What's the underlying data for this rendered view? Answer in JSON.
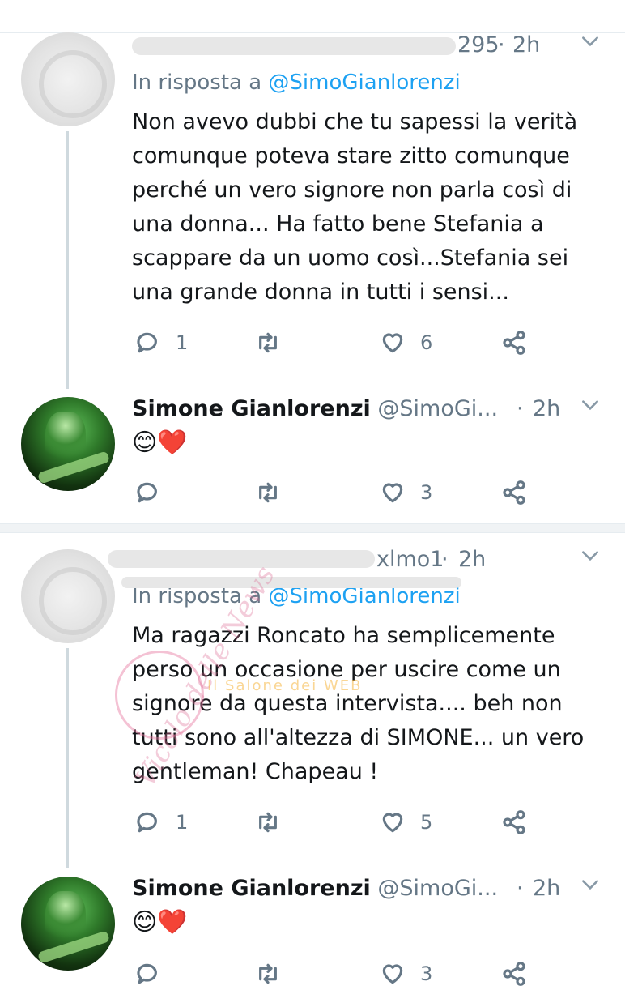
{
  "tweets": [
    {
      "type": "reply",
      "name": "",
      "handle_suffix": "295",
      "dot": "·",
      "time": "2h",
      "reply_prefix": "In risposta a",
      "reply_mention": "@SimoGianlorenzi",
      "text": "Non avevo dubbi che tu sapessi la  verità comunque poteva stare zitto comunque perché un vero signore non parla così di una donna... Ha fatto bene Stefania a scappare da un uomo così...Stefania sei una grande donna in tutti i sensi...",
      "actions": {
        "replies": "1",
        "retweets": "",
        "likes": "6"
      }
    },
    {
      "type": "author",
      "name": "Simone Gianlorenzi",
      "handle": "@SimoGi...",
      "dot": "·",
      "time": "2h",
      "text": "😊❤️",
      "actions": {
        "replies": "",
        "retweets": "",
        "likes": "3"
      }
    },
    {
      "type": "reply",
      "name": "",
      "handle_suffix": "xlmo1",
      "dot": "·",
      "time": "2h",
      "reply_prefix": "In risposta a",
      "reply_mention": "@SimoGianlorenzi",
      "text": "Ma ragazzi Roncato ha semplicemente perso un occasione per uscire come un signore da questa intervista.... beh non tutti sono all'altezza di SIMONE... un vero gentleman! Chapeau !",
      "actions": {
        "replies": "1",
        "retweets": "",
        "likes": "5"
      }
    },
    {
      "type": "author",
      "name": "Simone Gianlorenzi",
      "handle": "@SimoGi...",
      "dot": "·",
      "time": "2h",
      "text": "😊❤️",
      "actions": {
        "replies": "",
        "retweets": "",
        "likes": "3"
      }
    }
  ],
  "icons": {
    "reply": "reply-icon",
    "retweet": "retweet-icon",
    "like": "heart-icon",
    "share": "share-icon",
    "menu": "chevron-down-icon"
  },
  "colors": {
    "link": "#1da1f2",
    "muted": "#657786"
  },
  "watermark": {
    "text": "Vicolo delle News",
    "tagline": "Il Salone dei WEB"
  }
}
